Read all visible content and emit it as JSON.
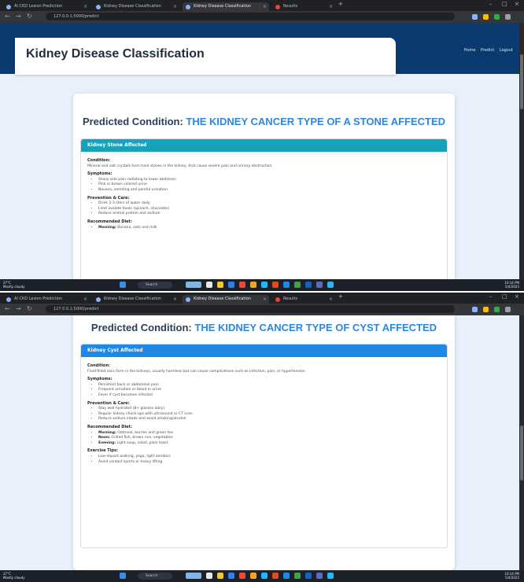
{
  "navbar": {
    "brand": "Kidney Disease Classification",
    "links": [
      "Home",
      "Predict",
      "Logout"
    ]
  },
  "shot1": {
    "heading_prefix": "Predicted Condition:",
    "condition": "THE KIDNEY CANCER TYPE OF A STONE AFFECTED",
    "panel_title": "Kidney Stone Affected",
    "sections": [
      {
        "title": "Condition:",
        "text": "Mineral and salt crystals form hard stones in the kidney, that cause severe pain and urinary obstruction."
      },
      {
        "title": "Symptoms:",
        "items": [
          "Sharp side pain radiating to lower abdomen",
          "Pink or brown colored urine",
          "Nausea, vomiting and painful urination"
        ]
      },
      {
        "title": "Prevention & Care:",
        "items": [
          "Drink 2-3 liters of water daily",
          "Limit oxalate foods (spinach, chocolate)",
          "Reduce animal protein and sodium"
        ]
      },
      {
        "title": "Recommended Diet:",
        "items": [
          {
            "label": "Morning:",
            "text": "Banana, oats and milk"
          }
        ]
      }
    ]
  },
  "shot2": {
    "heading_prefix": "Predicted Condition:",
    "condition": "THE KIDNEY CANCER TYPE OF CYST AFFECTED",
    "panel_title": "Kidney Cyst Affected",
    "sections": [
      {
        "title": "Condition:",
        "text": "Fluid-filled sacs form in the kidneys, usually harmless but can cause complications such as infection, pain, or hypertension."
      },
      {
        "title": "Symptoms:",
        "items": [
          "Persistent back or abdominal pain",
          "Frequent urination or blood in urine",
          "Fever if cyst becomes infected"
        ]
      },
      {
        "title": "Prevention & Care:",
        "items": [
          "Stay well hydrated (8+ glasses daily)",
          "Regular kidney check-ups with ultrasound or CT scan",
          "Reduce sodium intake and avoid smoking/alcohol"
        ]
      },
      {
        "title": "Recommended Diet:",
        "items": [
          {
            "label": "Morning:",
            "text": "Oatmeal, berries and green tea"
          },
          {
            "label": "Noon:",
            "text": "Grilled fish, brown rice, vegetables"
          },
          {
            "label": "Evening:",
            "text": "Light soup, salad, plain toast"
          }
        ]
      },
      {
        "title": "Exercise Tips:",
        "items": [
          "Low-impact walking, yoga, light aerobics",
          "Avoid contact sports or heavy lifting"
        ]
      }
    ]
  },
  "browser": {
    "tabs": [
      "AI CKD Lesion Prediction",
      "Kidney Disease Classification",
      "Kidney Disease Classification",
      "Results"
    ],
    "address": "127.0.0.1:5000/predict"
  },
  "taskbar": {
    "weather_temp": "27°C",
    "weather_desc": "Mostly cloudy",
    "search_label": "Search",
    "time": "10:14 PM",
    "date": "5/4/2025"
  },
  "icons": [
    "back-arrow-icon",
    "forward-arrow-icon",
    "reload-icon",
    "windows-icon",
    "search-icon",
    "close-icon"
  ],
  "colors": {
    "navbar": "#0b3a70",
    "condition_text": "#2e86de",
    "stone_header": "#16a2b8",
    "cyst_header": "#1e88e5",
    "page_bg": "#e7f0fb"
  }
}
